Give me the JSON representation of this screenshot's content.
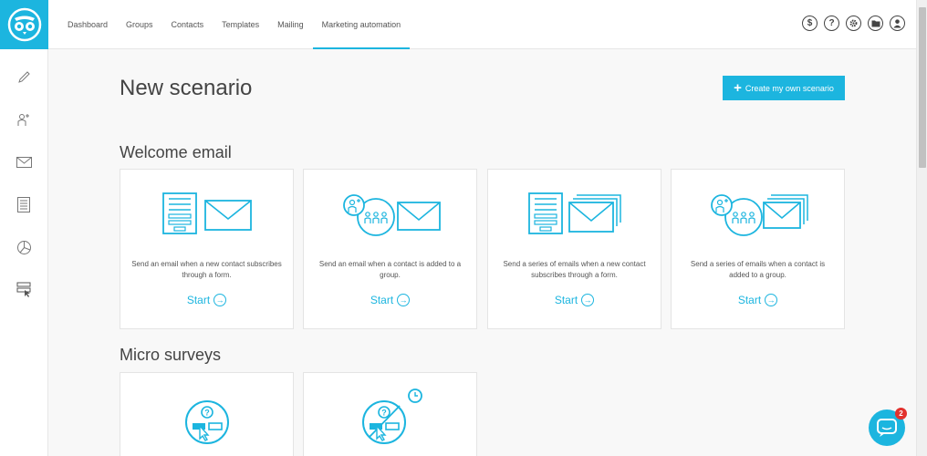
{
  "nav": {
    "items": [
      "Dashboard",
      "Groups",
      "Contacts",
      "Templates",
      "Mailing",
      "Marketing automation"
    ],
    "active_index": 5
  },
  "top_icons": [
    {
      "icon": "dollar-icon",
      "glyph": "$"
    },
    {
      "icon": "help-icon",
      "glyph": "?"
    },
    {
      "icon": "gear-icon",
      "glyph": "⚙"
    },
    {
      "icon": "folder-icon",
      "glyph": "▬"
    },
    {
      "icon": "user-icon",
      "glyph": "●"
    }
  ],
  "sidebar": [
    "pen-icon",
    "add-user-icon",
    "mail-icon",
    "document-icon",
    "pie-chart-icon",
    "layout-click-icon"
  ],
  "page": {
    "title": "New scenario",
    "create_button": "Create my own scenario"
  },
  "sections": {
    "welcome": {
      "title": "Welcome email",
      "cards": [
        {
          "description": "Send an email when a new contact subscribes through a form.",
          "start": "Start"
        },
        {
          "description": "Send an email when a contact is added to a group.",
          "start": "Start"
        },
        {
          "description": "Send a series of emails when a new contact subscribes through a form.",
          "start": "Start"
        },
        {
          "description": "Send a series of emails when a contact is added to a group.",
          "start": "Start"
        }
      ]
    },
    "surveys": {
      "title": "Micro surveys"
    }
  },
  "chat": {
    "badge": "2"
  },
  "colors": {
    "accent": "#1cb5df",
    "badge": "#e2312d"
  }
}
